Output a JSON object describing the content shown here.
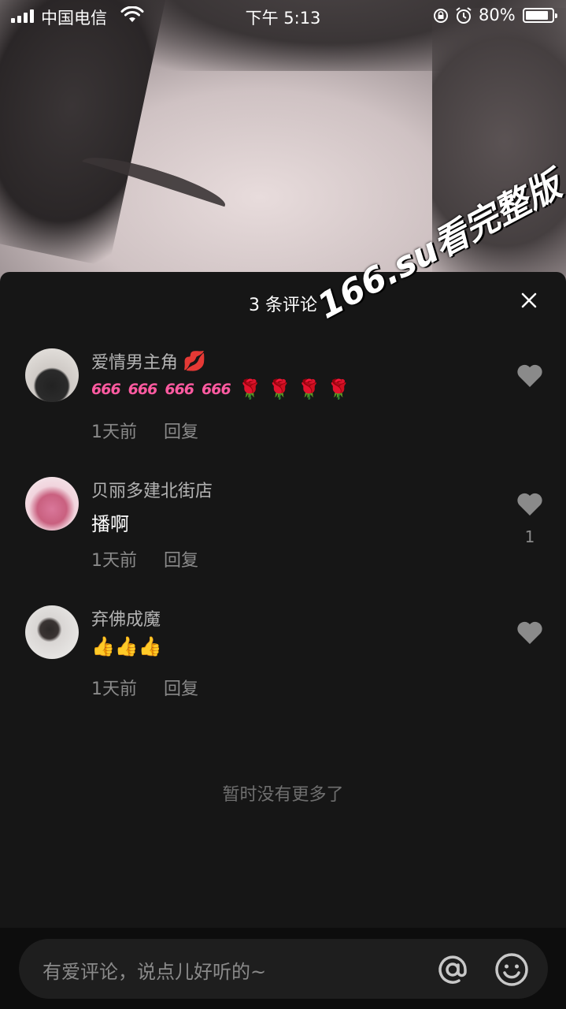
{
  "status_bar": {
    "carrier": "中国电信",
    "time": "下午 5:13",
    "battery": "80%"
  },
  "sheet": {
    "title": "3 条评论"
  },
  "watermark": "166.su看完整版",
  "comments": [
    {
      "username": "爱情男主角",
      "username_emoji": "💋",
      "text_parts": [
        "666",
        "666",
        "666",
        "666"
      ],
      "text_emoji": "🌹 🌹 🌹 🌹",
      "time": "1天前",
      "reply": "回复",
      "likes": ""
    },
    {
      "username": "贝丽多建北街店",
      "text": "播啊",
      "time": "1天前",
      "reply": "回复",
      "likes": "1"
    },
    {
      "username": "弃佛成魔",
      "text_emoji": "👍👍👍",
      "time": "1天前",
      "reply": "回复",
      "likes": ""
    }
  ],
  "no_more": "暂时没有更多了",
  "input": {
    "placeholder": "有爱评论，说点儿好听的~"
  },
  "colors": {
    "sheet_bg": "#161616",
    "text_secondary": "#8a8a8a",
    "like_icon": "#8a8a8a"
  }
}
